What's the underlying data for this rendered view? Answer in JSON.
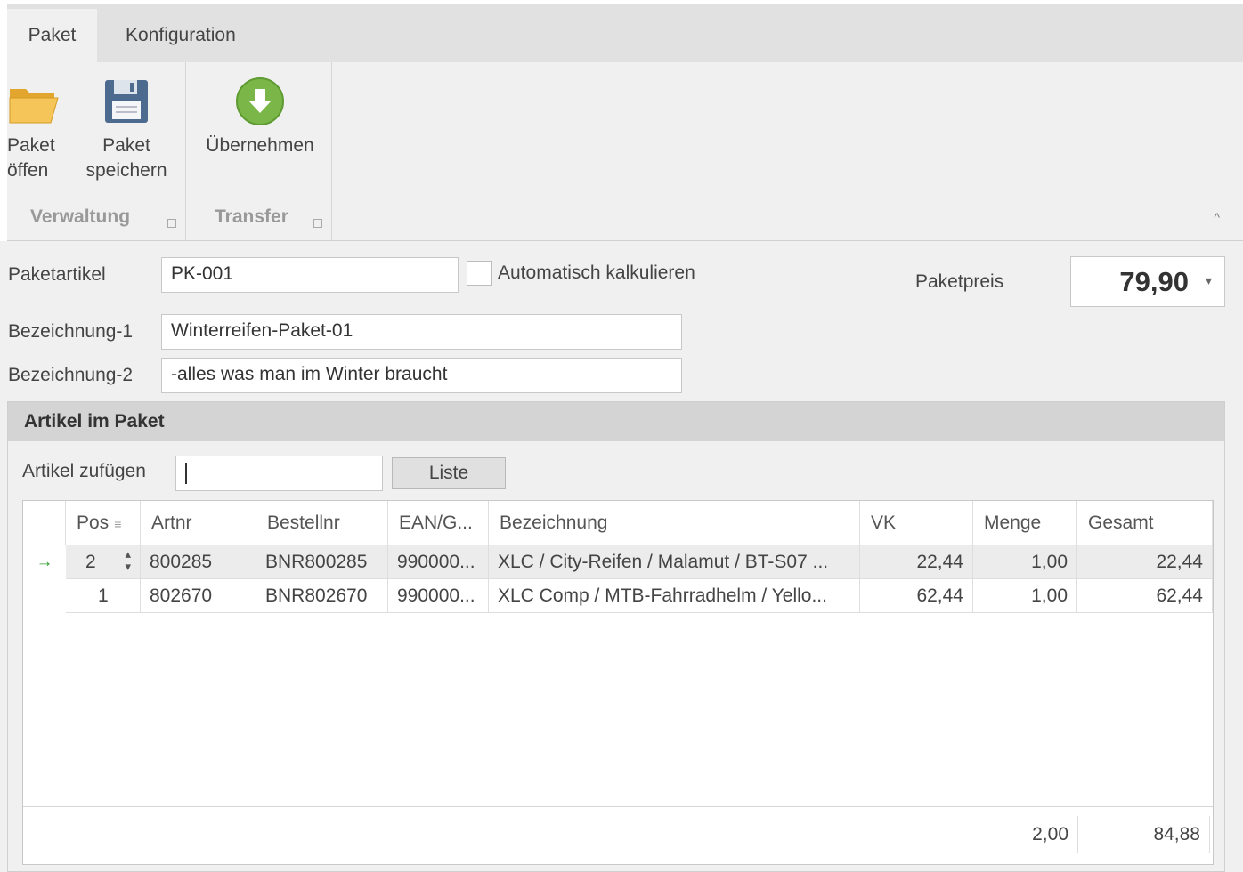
{
  "ribbon": {
    "tabs": [
      "Paket",
      "Konfiguration"
    ],
    "groups": {
      "verwaltung": {
        "label": "Verwaltung",
        "open_label": "Paket\nöffen",
        "save_label": "Paket\nspeichern"
      },
      "transfer": {
        "label": "Transfer",
        "apply_label": "Übernehmen"
      }
    }
  },
  "form": {
    "paketartikel_label": "Paketartikel",
    "paketartikel_value": "PK-001",
    "auto_calc_label": "Automatisch kalkulieren",
    "auto_calc_checked": false,
    "bez1_label": "Bezeichnung-1",
    "bez1_value": "Winterreifen-Paket-01",
    "bez2_label": "Bezeichnung-2",
    "bez2_value": "-alles was man im Winter braucht",
    "paketpreis_label": "Paketpreis",
    "paketpreis_value": "79,90"
  },
  "articles": {
    "title": "Artikel im Paket",
    "add_label": "Artikel zufügen",
    "add_value": "",
    "liste_label": "Liste",
    "columns": [
      "Pos",
      "Artnr",
      "Bestellnr",
      "EAN/G...",
      "Bezeichnung",
      "VK",
      "Menge",
      "Gesamt"
    ],
    "rows": [
      {
        "pos": "2",
        "artnr": "800285",
        "bestellnr": "BNR800285",
        "ean": "990000...",
        "bezeichnung": "XLC / City-Reifen / Malamut / BT-S07 ...",
        "vk": "22,44",
        "menge": "1,00",
        "gesamt": "22,44",
        "selected": true
      },
      {
        "pos": "1",
        "artnr": "802670",
        "bestellnr": "BNR802670",
        "ean": "990000...",
        "bezeichnung": "XLC Comp / MTB-Fahrradhelm / Yello...",
        "vk": "62,44",
        "menge": "1,00",
        "gesamt": "62,44",
        "selected": false
      }
    ],
    "totals": {
      "menge": "2,00",
      "gesamt": "84,88"
    }
  },
  "icons": {
    "open": "folder-open-icon",
    "save": "floppy-disk-icon",
    "apply": "green-download-arrow-icon",
    "row_indicator": "arrow-right-icon",
    "sort": "sort-icon",
    "spin": "spin-updown-icon",
    "dropdown": "chevron-down-icon"
  },
  "colors": {
    "accent_green": "#7ab648",
    "row_indicator": "#2e9e2e"
  }
}
